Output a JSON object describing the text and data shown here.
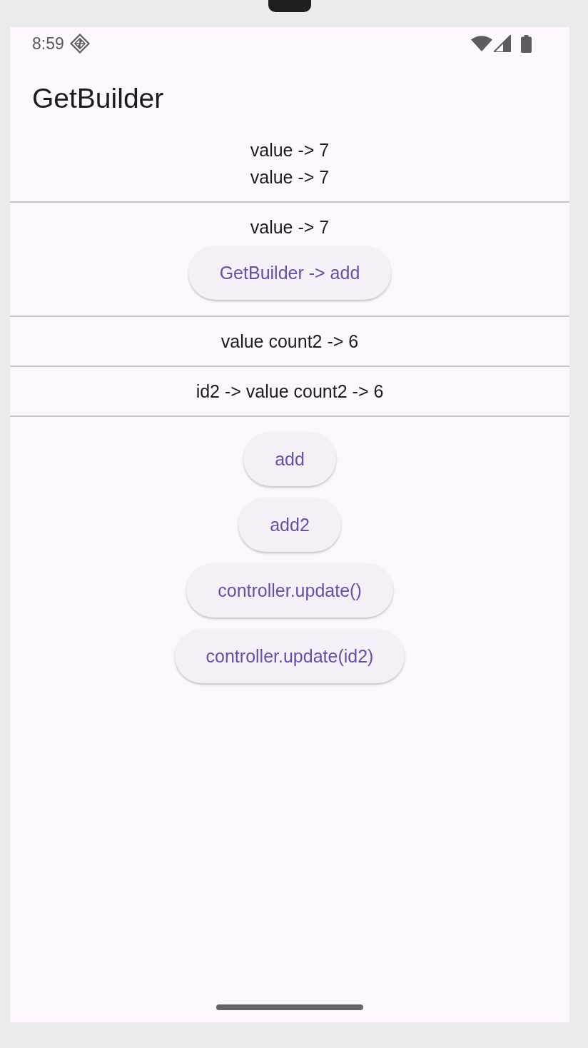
{
  "status_bar": {
    "time": "8:59"
  },
  "app_bar": {
    "title": "GetBuilder"
  },
  "sections": [
    {
      "texts": [
        "value -> 7",
        "value -> 7"
      ]
    },
    {
      "texts": [
        "value -> 7"
      ],
      "button": "GetBuilder -> add"
    },
    {
      "texts": [
        "value count2 -> 6"
      ]
    },
    {
      "texts": [
        "id2 -> value count2 -> 6"
      ]
    }
  ],
  "buttons": [
    "add",
    "add2",
    "controller.update()",
    "controller.update(id2)"
  ]
}
